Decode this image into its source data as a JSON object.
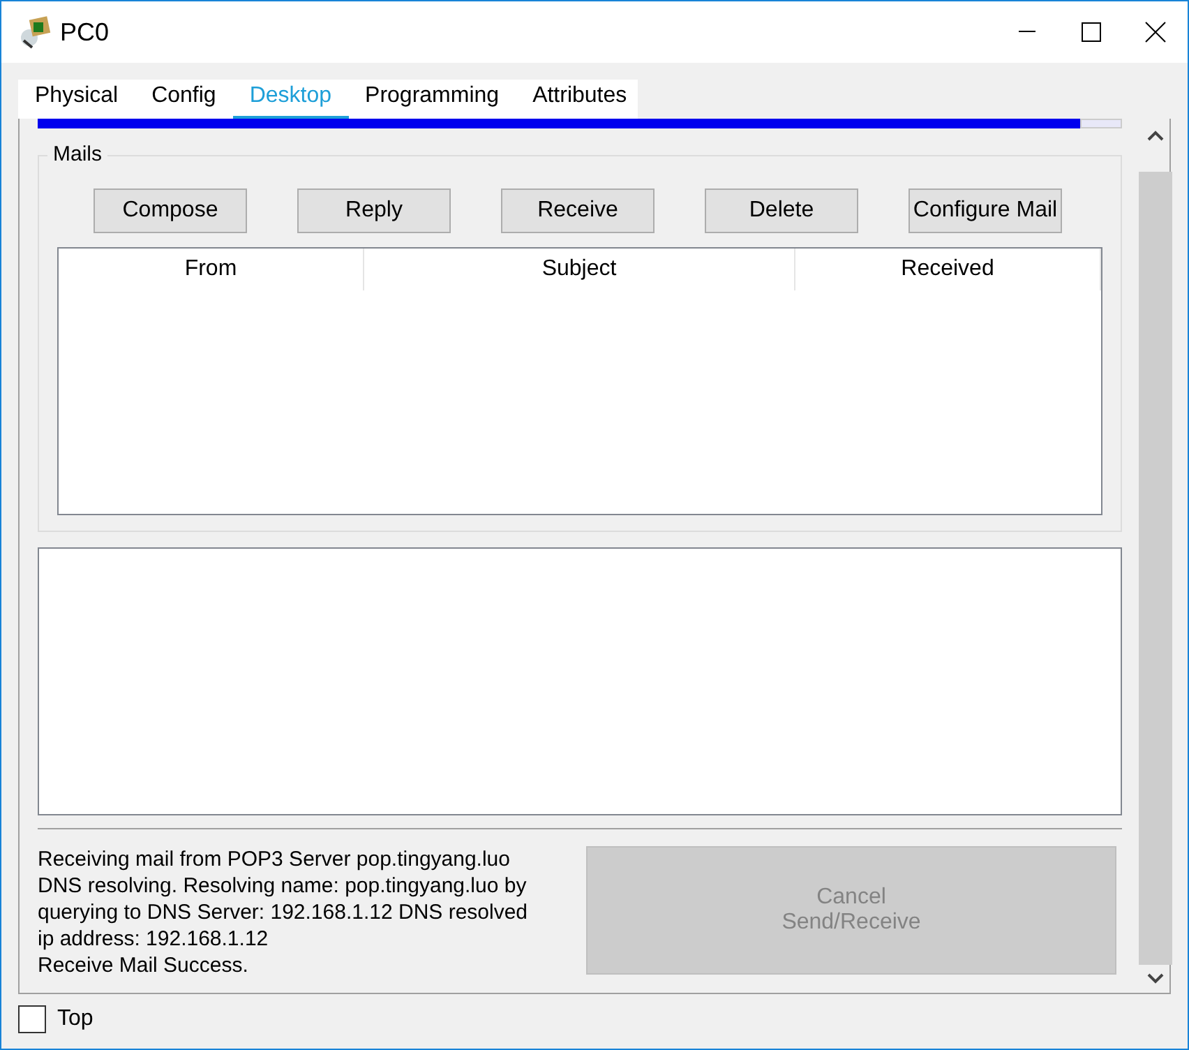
{
  "window": {
    "title": "PC0"
  },
  "tabs": [
    {
      "label": "Physical",
      "selected": false
    },
    {
      "label": "Config",
      "selected": false
    },
    {
      "label": "Desktop",
      "selected": true
    },
    {
      "label": "Programming",
      "selected": false
    },
    {
      "label": "Attributes",
      "selected": false
    }
  ],
  "mails": {
    "title": "Mails",
    "buttons": [
      "Compose",
      "Reply",
      "Receive",
      "Delete",
      "Configure Mail"
    ],
    "columns": [
      "From",
      "Subject",
      "Received"
    ]
  },
  "log": [
    "Receiving mail from POP3 Server pop.tingyang.luo",
    "DNS resolving. Resolving name: pop.tingyang.luo by",
    "querying to DNS Server: 192.168.1.12  DNS resolved",
    "ip address: 192.168.1.12",
    "Receive Mail Success."
  ],
  "cancel_button": {
    "lines": [
      "Cancel",
      "Send/Receive"
    ],
    "disabled": true
  },
  "top_checkbox": {
    "label": "Top",
    "checked": false
  }
}
